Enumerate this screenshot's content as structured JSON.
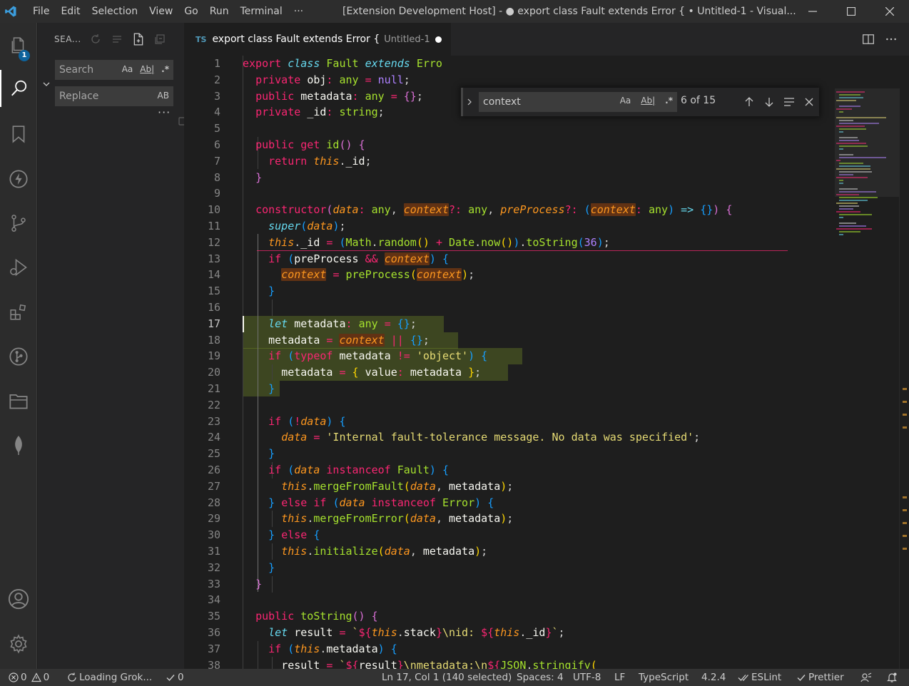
{
  "titlebar": {
    "menu": [
      "File",
      "Edit",
      "Selection",
      "View",
      "Go",
      "Run",
      "Terminal",
      "···"
    ],
    "title": "[Extension Development Host] - ● export class Fault extends Error { • Untitled-1 - Visual..."
  },
  "activitybar": {
    "explorer_badge": "1"
  },
  "sidebar": {
    "header": "SEA...",
    "search_placeholder": "Search",
    "replace_placeholder": "Replace",
    "opt_case": "Aa",
    "opt_word": "Ab|",
    "opt_regex": ".*",
    "opt_preserve": "AB",
    "more": "···"
  },
  "tab": {
    "lang": "TS",
    "title": "export class Fault extends Error {",
    "desc": "Untitled-1"
  },
  "find": {
    "value": "context",
    "count": "6 of 15",
    "opt_case": "Aa",
    "opt_word": "Ab|",
    "opt_regex": ".*"
  },
  "editor": {
    "current_line": 17,
    "line_numbers": [
      "1",
      "2",
      "3",
      "4",
      "5",
      "6",
      "7",
      "8",
      "9",
      "10",
      "11",
      "12",
      "13",
      "14",
      "15",
      "16",
      "17",
      "18",
      "19",
      "20",
      "21",
      "22",
      "23",
      "24",
      "25",
      "26",
      "27",
      "28",
      "29",
      "30",
      "31",
      "32",
      "33",
      "34",
      "35",
      "36",
      "37",
      "38"
    ]
  },
  "status": {
    "errors": "0",
    "warnings": "0",
    "grok": "Loading Grok...",
    "checks": "0",
    "position": "Ln 17, Col 1 (140 selected)",
    "spaces": "Spaces: 4",
    "encoding": "UTF-8",
    "eol": "LF",
    "language": "TypeScript",
    "version": "4.2.4",
    "eslint": "ESLint",
    "prettier": "Prettier"
  },
  "colors": {
    "accent": "#0e639c",
    "find_highlight": "#613214",
    "selection": "#4a4f24"
  }
}
